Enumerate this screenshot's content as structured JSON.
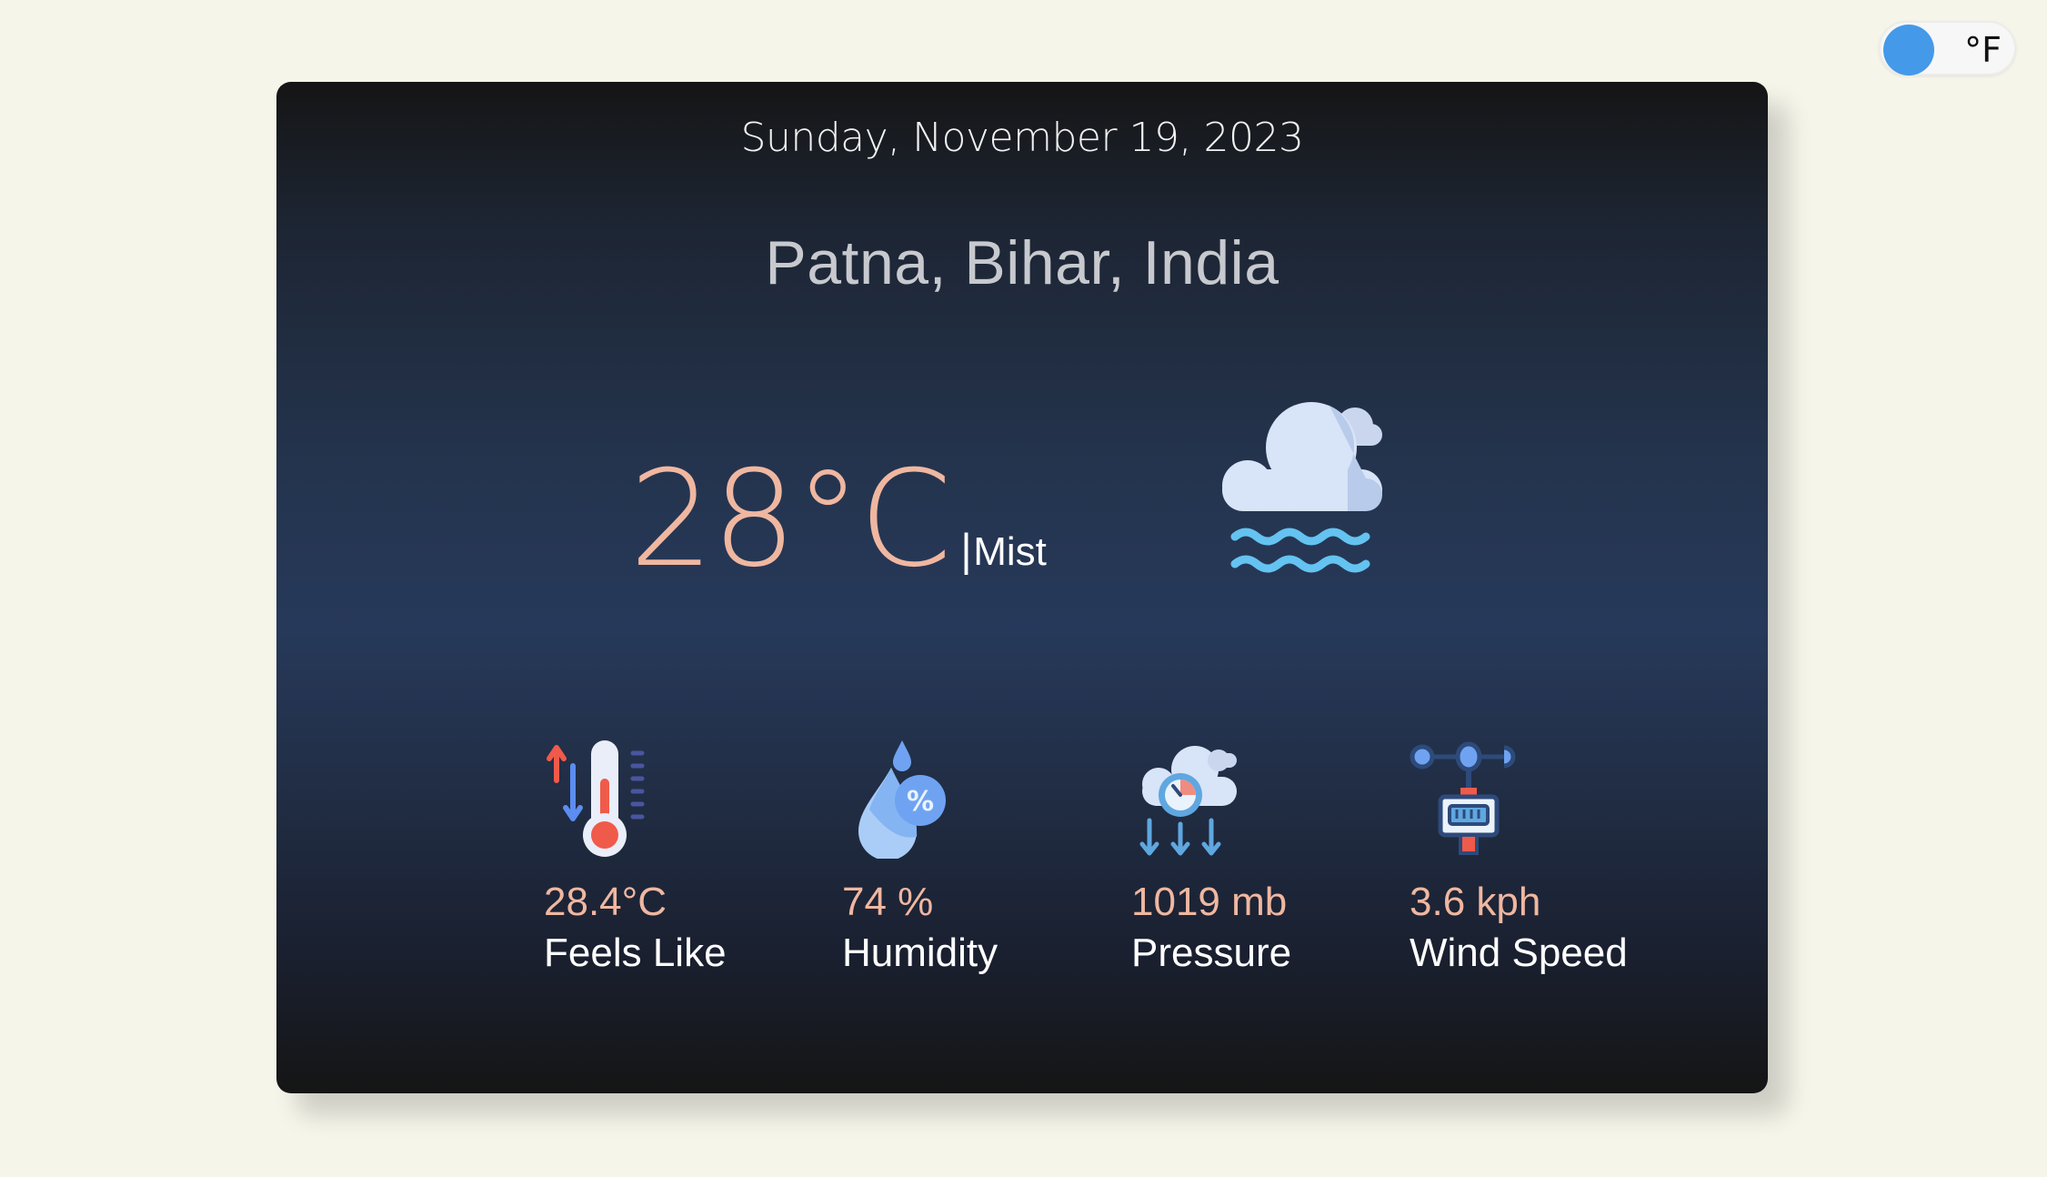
{
  "toggle": {
    "label": "°F",
    "knob_color": "#4499e9"
  },
  "card": {
    "date": "Sunday, November 19, 2023",
    "location": "Patna, Bihar, India",
    "temperature": "28°C",
    "separator": "|",
    "condition": "Mist",
    "condition_icon": "mist-cloud-icon"
  },
  "stats": [
    {
      "icon": "thermometer-icon",
      "value": "28.4°C",
      "label": "Feels Like"
    },
    {
      "icon": "humidity-drop-icon",
      "value": "74 %",
      "label": "Humidity"
    },
    {
      "icon": "pressure-gauge-icon",
      "value": "1019 mb",
      "label": "Pressure"
    },
    {
      "icon": "anemometer-icon",
      "value": "3.6 kph",
      "label": "Wind Speed"
    }
  ],
  "colors": {
    "page_bg": "#f5f5ea",
    "accent_value": "#f0b7a0",
    "location": "#c7c9ce"
  }
}
